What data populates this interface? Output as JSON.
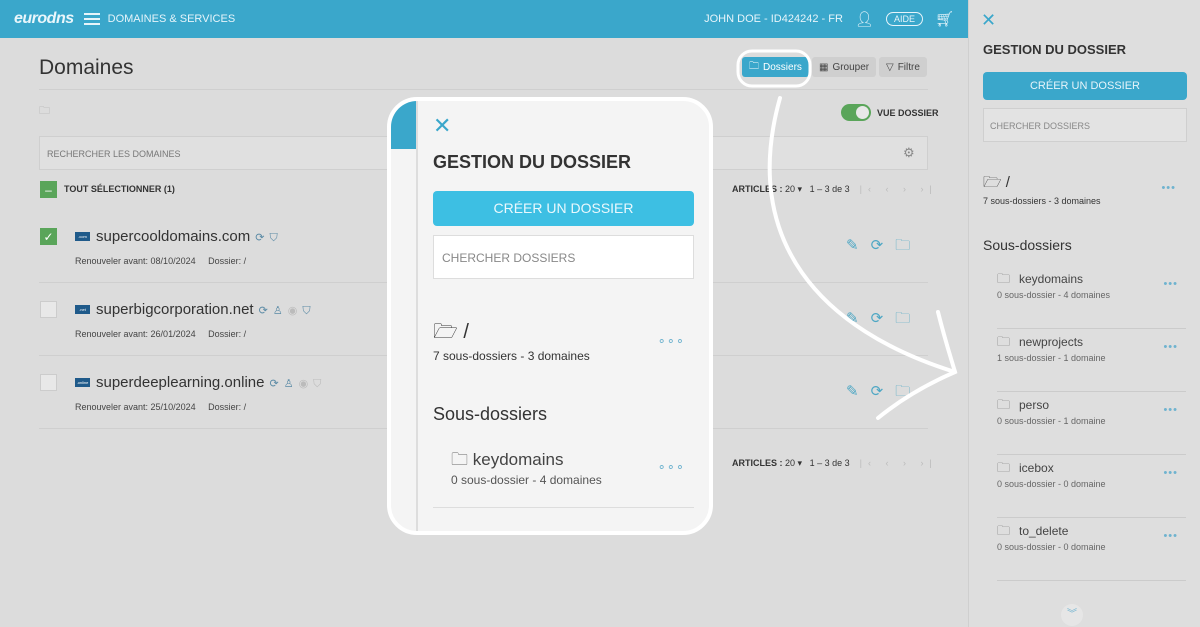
{
  "header": {
    "logo": "eurodns",
    "section": "DOMAINES & SERVICES",
    "user": "JOHN DOE - ID424242 - FR",
    "help": "AIDE"
  },
  "page": {
    "title": "Domaines",
    "buttons": {
      "folders": "Dossiers",
      "group": "Grouper",
      "filter": "Filtre"
    },
    "folder_view_label": "VUE DOSSIER",
    "folder_view_on": true,
    "search_placeholder": "RECHERCHER LES DOMAINES",
    "select_all": "TOUT SÉLECTIONNER (1)"
  },
  "pagination": {
    "label": "ARTICLES :",
    "per_page": "20",
    "range": "1 – 3 de 3"
  },
  "domains": [
    {
      "name": "supercooldomains.com",
      "tld": ".com",
      "renew": "Renouveler avant: 08/10/2024",
      "folder": "Dossier: /",
      "checked": true
    },
    {
      "name": "superbigcorporation.net",
      "tld": ".net",
      "renew": "Renouveler avant: 26/01/2024",
      "folder": "Dossier: /",
      "checked": false
    },
    {
      "name": "superdeeplearning.online",
      "tld": ".online",
      "renew": "Renouveler avant: 25/10/2024",
      "folder": "Dossier: /",
      "checked": false
    }
  ],
  "panel": {
    "title": "GESTION DU DOSSIER",
    "create": "CRÉER UN DOSSIER",
    "search_placeholder": "CHERCHER DOSSIERS",
    "root": {
      "name": "/",
      "desc": "7 sous-dossiers - 3 domaines"
    },
    "subheading": "Sous-dossiers",
    "folders": [
      {
        "name": "keydomains",
        "desc": "0 sous-dossier - 4 domaines"
      },
      {
        "name": "newprojects",
        "desc": "1 sous-dossier - 1 domaine"
      },
      {
        "name": "perso",
        "desc": "0 sous-dossier - 1 domaine"
      },
      {
        "name": "icebox",
        "desc": "0 sous-dossier - 0 domaine"
      },
      {
        "name": "to_delete",
        "desc": "0 sous-dossier - 0 domaine"
      }
    ]
  },
  "colors": {
    "brand": "#3aa7cb",
    "success": "#5aa55a"
  }
}
